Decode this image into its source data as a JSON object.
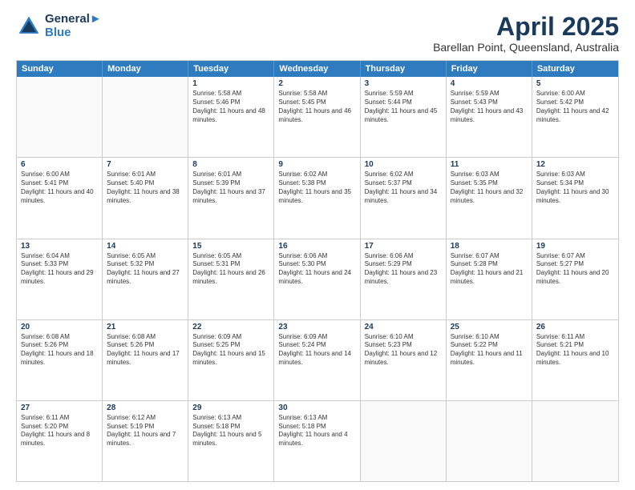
{
  "header": {
    "logo_line1": "General",
    "logo_line2": "Blue",
    "month_title": "April 2025",
    "subtitle": "Barellan Point, Queensland, Australia"
  },
  "weekdays": [
    "Sunday",
    "Monday",
    "Tuesday",
    "Wednesday",
    "Thursday",
    "Friday",
    "Saturday"
  ],
  "rows": [
    [
      {
        "day": "",
        "sunrise": "",
        "sunset": "",
        "daylight": ""
      },
      {
        "day": "",
        "sunrise": "",
        "sunset": "",
        "daylight": ""
      },
      {
        "day": "1",
        "sunrise": "Sunrise: 5:58 AM",
        "sunset": "Sunset: 5:46 PM",
        "daylight": "Daylight: 11 hours and 48 minutes."
      },
      {
        "day": "2",
        "sunrise": "Sunrise: 5:58 AM",
        "sunset": "Sunset: 5:45 PM",
        "daylight": "Daylight: 11 hours and 46 minutes."
      },
      {
        "day": "3",
        "sunrise": "Sunrise: 5:59 AM",
        "sunset": "Sunset: 5:44 PM",
        "daylight": "Daylight: 11 hours and 45 minutes."
      },
      {
        "day": "4",
        "sunrise": "Sunrise: 5:59 AM",
        "sunset": "Sunset: 5:43 PM",
        "daylight": "Daylight: 11 hours and 43 minutes."
      },
      {
        "day": "5",
        "sunrise": "Sunrise: 6:00 AM",
        "sunset": "Sunset: 5:42 PM",
        "daylight": "Daylight: 11 hours and 42 minutes."
      }
    ],
    [
      {
        "day": "6",
        "sunrise": "Sunrise: 6:00 AM",
        "sunset": "Sunset: 5:41 PM",
        "daylight": "Daylight: 11 hours and 40 minutes."
      },
      {
        "day": "7",
        "sunrise": "Sunrise: 6:01 AM",
        "sunset": "Sunset: 5:40 PM",
        "daylight": "Daylight: 11 hours and 38 minutes."
      },
      {
        "day": "8",
        "sunrise": "Sunrise: 6:01 AM",
        "sunset": "Sunset: 5:39 PM",
        "daylight": "Daylight: 11 hours and 37 minutes."
      },
      {
        "day": "9",
        "sunrise": "Sunrise: 6:02 AM",
        "sunset": "Sunset: 5:38 PM",
        "daylight": "Daylight: 11 hours and 35 minutes."
      },
      {
        "day": "10",
        "sunrise": "Sunrise: 6:02 AM",
        "sunset": "Sunset: 5:37 PM",
        "daylight": "Daylight: 11 hours and 34 minutes."
      },
      {
        "day": "11",
        "sunrise": "Sunrise: 6:03 AM",
        "sunset": "Sunset: 5:35 PM",
        "daylight": "Daylight: 11 hours and 32 minutes."
      },
      {
        "day": "12",
        "sunrise": "Sunrise: 6:03 AM",
        "sunset": "Sunset: 5:34 PM",
        "daylight": "Daylight: 11 hours and 30 minutes."
      }
    ],
    [
      {
        "day": "13",
        "sunrise": "Sunrise: 6:04 AM",
        "sunset": "Sunset: 5:33 PM",
        "daylight": "Daylight: 11 hours and 29 minutes."
      },
      {
        "day": "14",
        "sunrise": "Sunrise: 6:05 AM",
        "sunset": "Sunset: 5:32 PM",
        "daylight": "Daylight: 11 hours and 27 minutes."
      },
      {
        "day": "15",
        "sunrise": "Sunrise: 6:05 AM",
        "sunset": "Sunset: 5:31 PM",
        "daylight": "Daylight: 11 hours and 26 minutes."
      },
      {
        "day": "16",
        "sunrise": "Sunrise: 6:06 AM",
        "sunset": "Sunset: 5:30 PM",
        "daylight": "Daylight: 11 hours and 24 minutes."
      },
      {
        "day": "17",
        "sunrise": "Sunrise: 6:06 AM",
        "sunset": "Sunset: 5:29 PM",
        "daylight": "Daylight: 11 hours and 23 minutes."
      },
      {
        "day": "18",
        "sunrise": "Sunrise: 6:07 AM",
        "sunset": "Sunset: 5:28 PM",
        "daylight": "Daylight: 11 hours and 21 minutes."
      },
      {
        "day": "19",
        "sunrise": "Sunrise: 6:07 AM",
        "sunset": "Sunset: 5:27 PM",
        "daylight": "Daylight: 11 hours and 20 minutes."
      }
    ],
    [
      {
        "day": "20",
        "sunrise": "Sunrise: 6:08 AM",
        "sunset": "Sunset: 5:26 PM",
        "daylight": "Daylight: 11 hours and 18 minutes."
      },
      {
        "day": "21",
        "sunrise": "Sunrise: 6:08 AM",
        "sunset": "Sunset: 5:26 PM",
        "daylight": "Daylight: 11 hours and 17 minutes."
      },
      {
        "day": "22",
        "sunrise": "Sunrise: 6:09 AM",
        "sunset": "Sunset: 5:25 PM",
        "daylight": "Daylight: 11 hours and 15 minutes."
      },
      {
        "day": "23",
        "sunrise": "Sunrise: 6:09 AM",
        "sunset": "Sunset: 5:24 PM",
        "daylight": "Daylight: 11 hours and 14 minutes."
      },
      {
        "day": "24",
        "sunrise": "Sunrise: 6:10 AM",
        "sunset": "Sunset: 5:23 PM",
        "daylight": "Daylight: 11 hours and 12 minutes."
      },
      {
        "day": "25",
        "sunrise": "Sunrise: 6:10 AM",
        "sunset": "Sunset: 5:22 PM",
        "daylight": "Daylight: 11 hours and 11 minutes."
      },
      {
        "day": "26",
        "sunrise": "Sunrise: 6:11 AM",
        "sunset": "Sunset: 5:21 PM",
        "daylight": "Daylight: 11 hours and 10 minutes."
      }
    ],
    [
      {
        "day": "27",
        "sunrise": "Sunrise: 6:11 AM",
        "sunset": "Sunset: 5:20 PM",
        "daylight": "Daylight: 11 hours and 8 minutes."
      },
      {
        "day": "28",
        "sunrise": "Sunrise: 6:12 AM",
        "sunset": "Sunset: 5:19 PM",
        "daylight": "Daylight: 11 hours and 7 minutes."
      },
      {
        "day": "29",
        "sunrise": "Sunrise: 6:13 AM",
        "sunset": "Sunset: 5:18 PM",
        "daylight": "Daylight: 11 hours and 5 minutes."
      },
      {
        "day": "30",
        "sunrise": "Sunrise: 6:13 AM",
        "sunset": "Sunset: 5:18 PM",
        "daylight": "Daylight: 11 hours and 4 minutes."
      },
      {
        "day": "",
        "sunrise": "",
        "sunset": "",
        "daylight": ""
      },
      {
        "day": "",
        "sunrise": "",
        "sunset": "",
        "daylight": ""
      },
      {
        "day": "",
        "sunrise": "",
        "sunset": "",
        "daylight": ""
      }
    ]
  ]
}
